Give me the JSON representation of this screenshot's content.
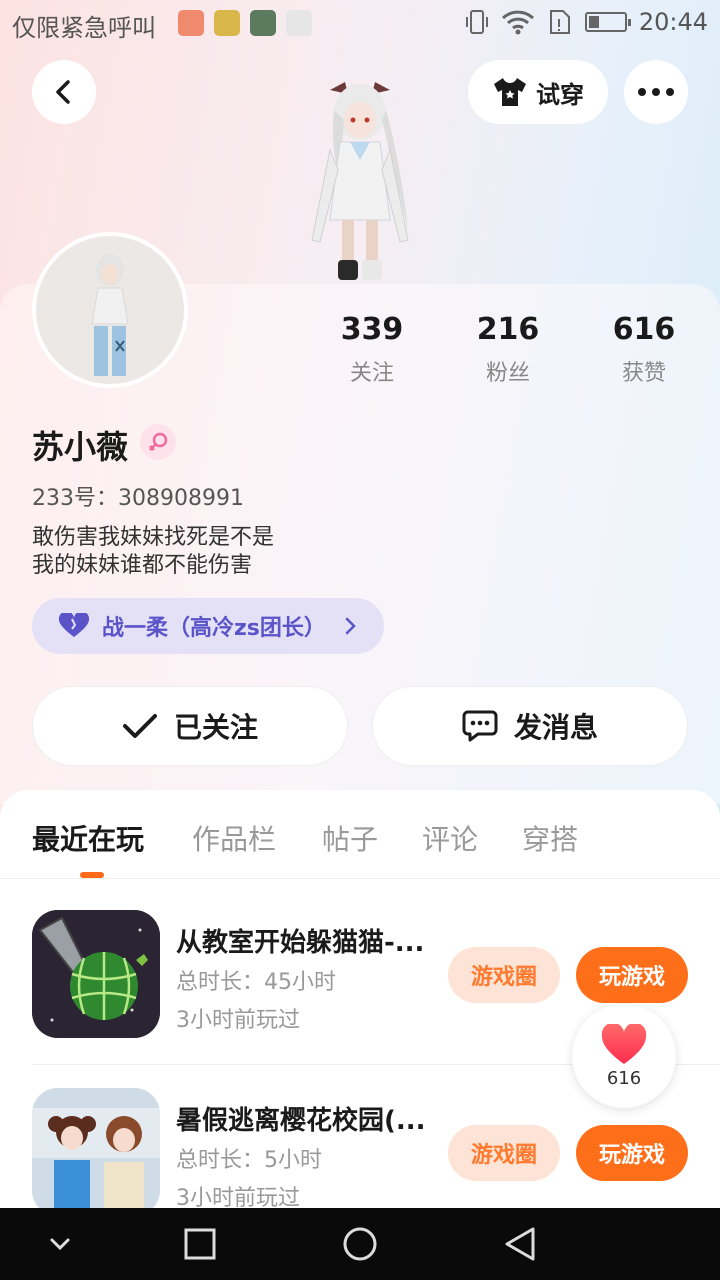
{
  "status_bar": {
    "left_text": "仅限紧急呼叫",
    "time": "20:44"
  },
  "top_bar": {
    "try_on_label": "试穿"
  },
  "profile": {
    "name": "苏小薇",
    "gender_icon": "female-icon",
    "uid": "233号：308908991",
    "bio_line1": "敢伤害我妹妹找死是不是",
    "bio_line2": "我的妹妹谁都不能伤害",
    "team_label": "战一柔（高冷zs团长）",
    "stats": [
      {
        "value": "339",
        "label": "关注"
      },
      {
        "value": "216",
        "label": "粉丝"
      },
      {
        "value": "616",
        "label": "获赞"
      }
    ]
  },
  "actions": {
    "follow_label": "已关注",
    "message_label": "发消息"
  },
  "tabs": [
    {
      "label": "最近在玩",
      "active": true
    },
    {
      "label": "作品栏",
      "active": false
    },
    {
      "label": "帖子",
      "active": false
    },
    {
      "label": "评论",
      "active": false
    },
    {
      "label": "穿搭",
      "active": false
    }
  ],
  "games": [
    {
      "title": "从教室开始躲猫猫-...",
      "duration": "总时长：45小时",
      "last_played": "3小时前玩过",
      "circle_label": "游戏圈",
      "play_label": "玩游戏"
    },
    {
      "title": "暑假逃离樱花校园(...",
      "duration": "总时长：5小时",
      "last_played": "3小时前玩过",
      "circle_label": "游戏圈",
      "play_label": "玩游戏"
    }
  ],
  "like_float": {
    "count": "616"
  },
  "colors": {
    "accent": "#ff6f1a",
    "team_bg": "#e4e1f6",
    "team_text": "#5b54c9"
  }
}
